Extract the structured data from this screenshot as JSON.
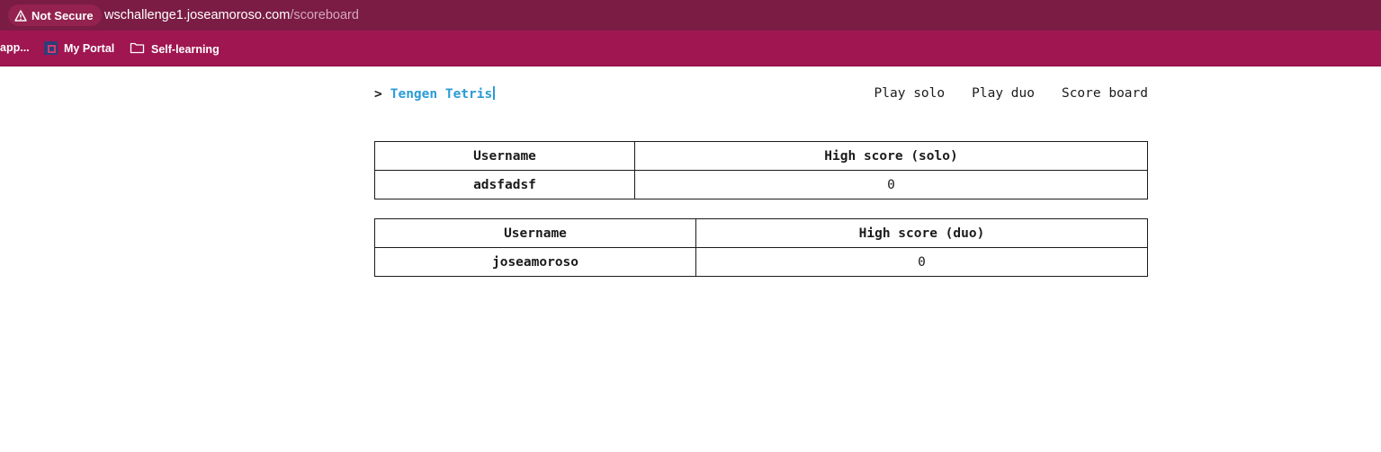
{
  "browser": {
    "security_label": "Not Secure",
    "url_host": "wschallenge1.joseamoroso.com",
    "url_path": "/scoreboard",
    "bookmarks": [
      {
        "label": "app...",
        "icon": "apps-icon"
      },
      {
        "label": "My Portal",
        "icon": "portal-icon"
      },
      {
        "label": "Self-learning",
        "icon": "folder-icon"
      }
    ],
    "colors": {
      "addressbar": "#7a1c44",
      "bookmarks_bar": "#a01651"
    }
  },
  "header": {
    "prompt": ">",
    "title": "Tengen Tetris",
    "nav": [
      "Play solo",
      "Play duo",
      "Score board"
    ],
    "accent": "#2a9bd6"
  },
  "tables": {
    "solo": {
      "headers": [
        "Username",
        "High score (solo)"
      ],
      "rows": [
        [
          "adsfadsf",
          "0"
        ]
      ]
    },
    "duo": {
      "headers": [
        "Username",
        "High score (duo)"
      ],
      "rows": [
        [
          "joseamoroso",
          "0"
        ]
      ]
    }
  }
}
